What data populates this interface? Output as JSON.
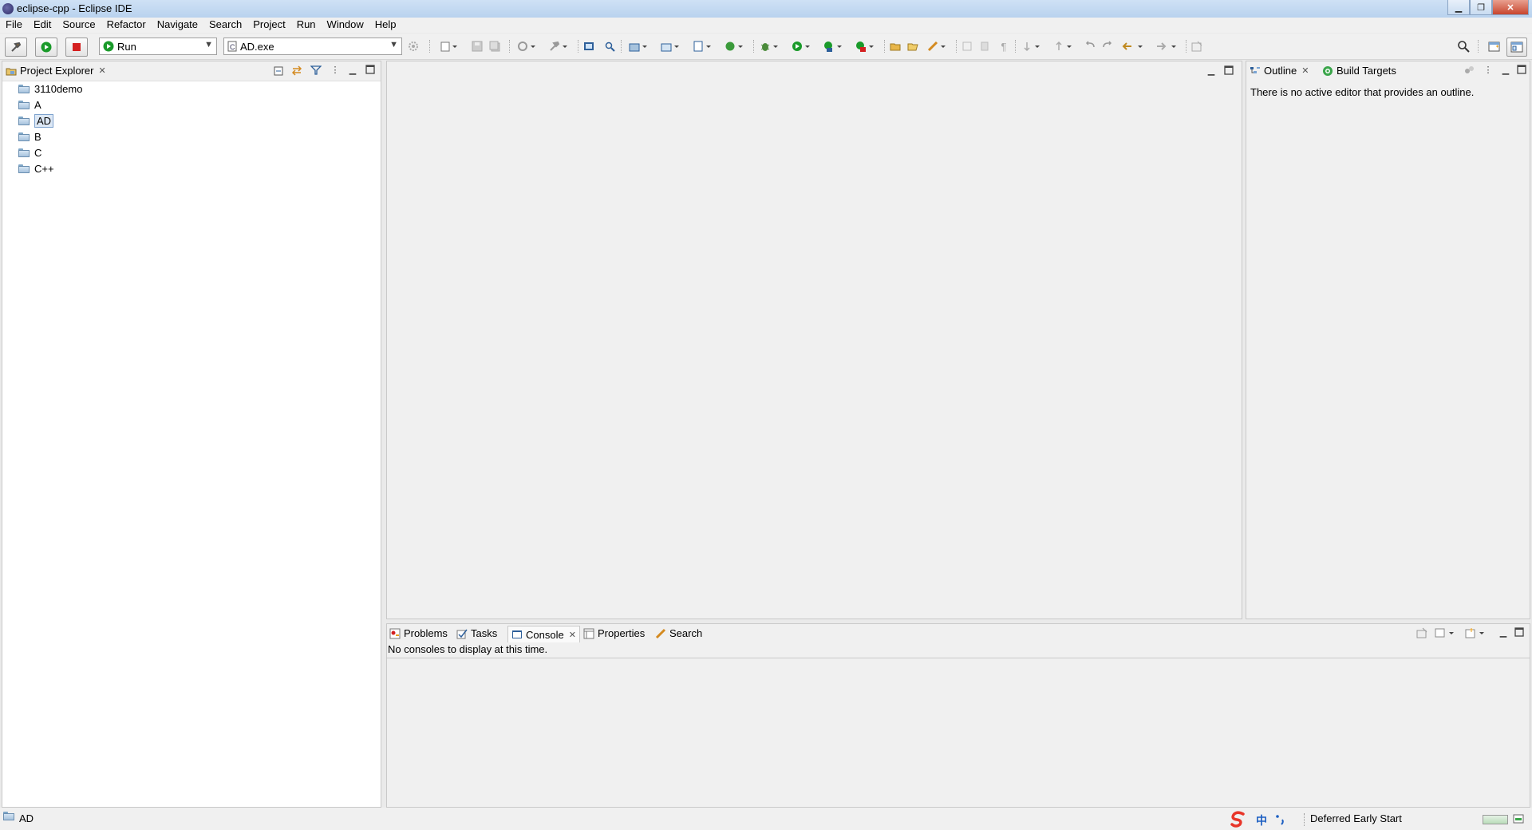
{
  "window": {
    "title": "eclipse-cpp - Eclipse IDE"
  },
  "menu": [
    "File",
    "Edit",
    "Source",
    "Refactor",
    "Navigate",
    "Search",
    "Project",
    "Run",
    "Window",
    "Help"
  ],
  "toolbar": {
    "launch_mode": "Run",
    "launch_config": "AD.exe"
  },
  "project_explorer": {
    "tab_label": "Project Explorer",
    "items": [
      "3110demo",
      "A",
      "AD",
      "B",
      "C",
      "C++"
    ],
    "selected": "AD"
  },
  "outline": {
    "tabs": [
      "Outline",
      "Build Targets"
    ],
    "message": "There is no active editor that provides an outline."
  },
  "bottom_panel": {
    "tabs": [
      "Problems",
      "Tasks",
      "Console",
      "Properties",
      "Search"
    ],
    "active_tab": "Console",
    "message": "No consoles to display at this time."
  },
  "status": {
    "selection": "AD",
    "ime": "中",
    "job": "Deferred Early Start"
  },
  "colors": {
    "run_green": "#1a9a2a",
    "stop_red": "#d42020",
    "sogou_red": "#e8362a",
    "selection_bg": "#dde8f5"
  }
}
